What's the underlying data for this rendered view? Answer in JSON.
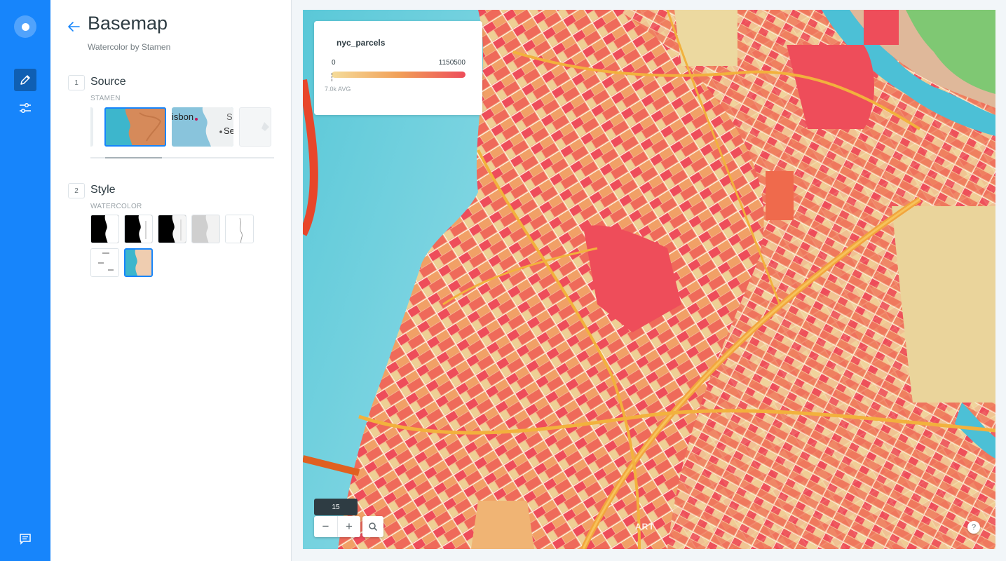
{
  "rail": {
    "items": [
      {
        "name": "logo",
        "icon": "carto-logo-icon"
      },
      {
        "name": "edit",
        "icon": "pencil-icon",
        "active": true
      },
      {
        "name": "settings",
        "icon": "sliders-icon"
      },
      {
        "name": "feedback",
        "icon": "chat-icon"
      }
    ],
    "accent": "#1785fb"
  },
  "panel": {
    "title": "Basemap",
    "subtitle": "Watercolor by Stamen",
    "source": {
      "step": "1",
      "title": "Source",
      "caption": "STAMEN",
      "thumbnails": [
        {
          "name": "watercolor",
          "selected": true
        },
        {
          "name": "lisbon",
          "selected": false,
          "text_1": "isbon",
          "text_2": "S",
          "text_3": "Se"
        },
        {
          "name": "custom",
          "selected": false
        }
      ]
    },
    "style": {
      "step": "2",
      "title": "Style",
      "caption": "WATERCOLOR",
      "thumbnails": [
        {
          "name": "toner",
          "selected": false
        },
        {
          "name": "toner-background",
          "selected": false
        },
        {
          "name": "toner-lite-dark",
          "selected": false
        },
        {
          "name": "toner-grey",
          "selected": false
        },
        {
          "name": "toner-lines",
          "selected": false
        },
        {
          "name": "toner-labels",
          "selected": false
        },
        {
          "name": "watercolor",
          "selected": true
        }
      ]
    }
  },
  "map": {
    "legend": {
      "title": "nyc_parcels",
      "min": "0",
      "max": "1150500",
      "avg": "7.0k AVG"
    },
    "zoom": "15",
    "zoom_out": "−",
    "zoom_in": "+",
    "help": "?",
    "attribution": "ART"
  }
}
